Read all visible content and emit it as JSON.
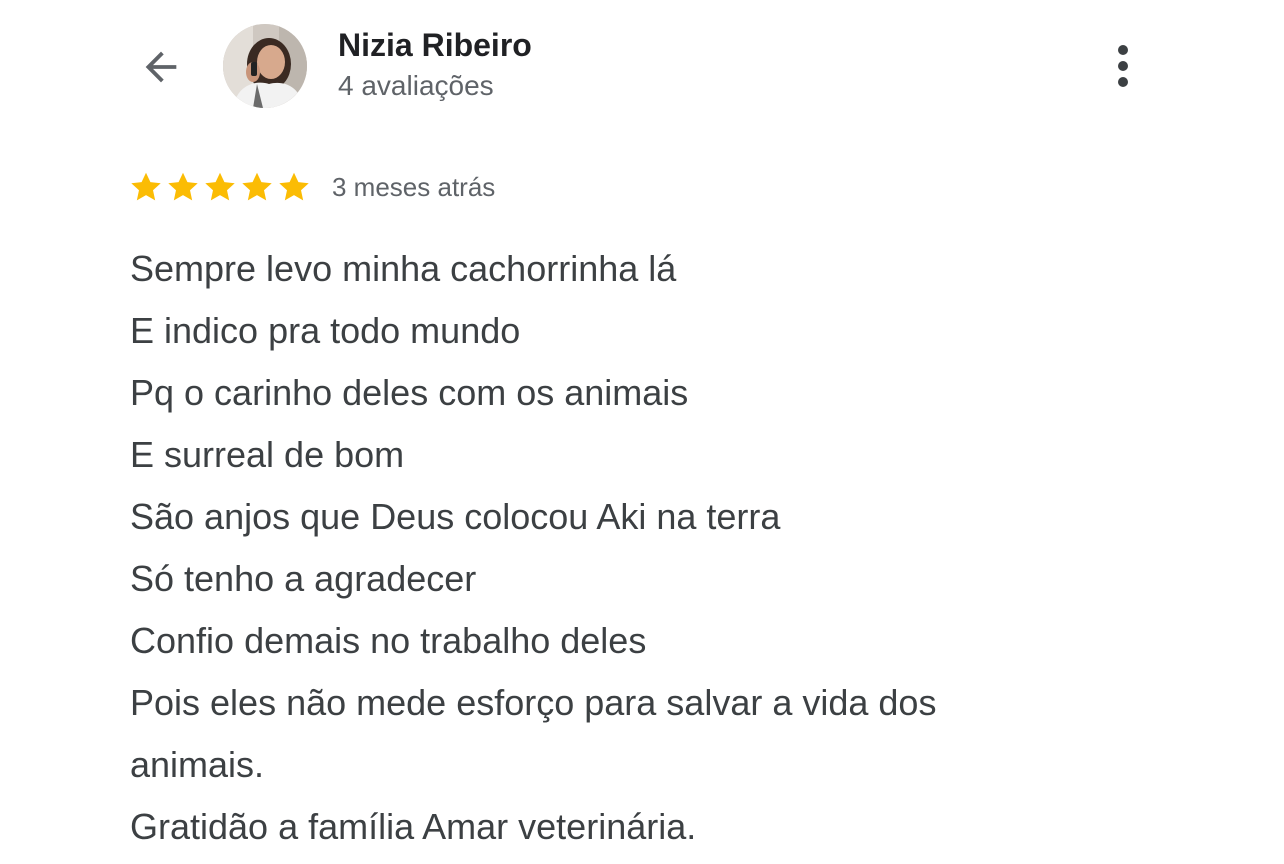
{
  "header": {
    "back_icon": "arrow-back-icon",
    "avatar_icon": "profile-photo",
    "reviewer_name": "Nizia Ribeiro",
    "review_count": "4 avaliações",
    "menu_icon": "more-vert-icon"
  },
  "review": {
    "rating": 5,
    "max_rating": 5,
    "star_icon": "star-icon",
    "star_color": "#fbbc04",
    "date": "3 meses atrás",
    "lines": [
      "Sempre levo minha cachorrinha lá",
      "E indico pra todo mundo",
      "Pq o carinho deles com os animais",
      "E surreal de bom",
      "São anjos que Deus colocou Aki na terra",
      "Só tenho a agradecer",
      "Confio demais no trabalho deles",
      "Pois eles não mede esforço para salvar a vida dos",
      "animais.",
      "Gratidão a família Amar veterinária."
    ]
  },
  "colors": {
    "name_text": "#202124",
    "secondary_text": "#5f6368",
    "body_text": "#3c4043",
    "background": "#ffffff"
  }
}
